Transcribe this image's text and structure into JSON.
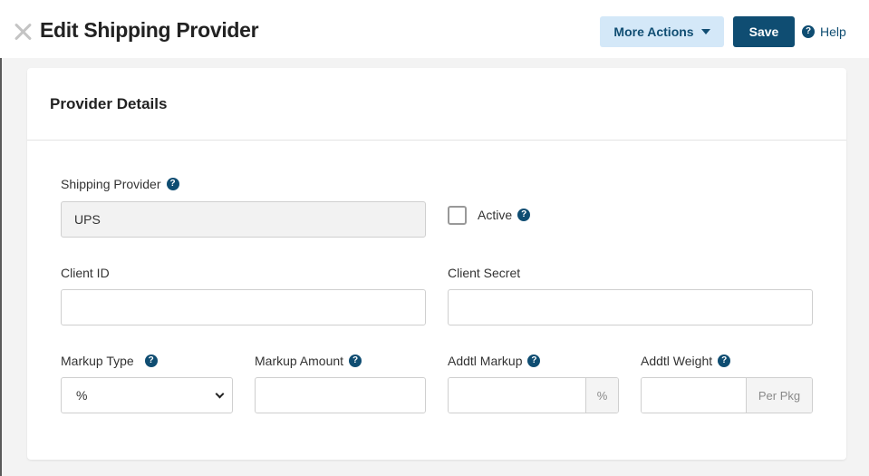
{
  "header": {
    "title": "Edit Shipping Provider",
    "more_actions_label": "More Actions",
    "save_label": "Save",
    "help_label": "Help"
  },
  "card": {
    "title": "Provider Details",
    "shipping_provider": {
      "label": "Shipping Provider",
      "value": "UPS"
    },
    "active": {
      "label": "Active",
      "checked": false
    },
    "client_id": {
      "label": "Client ID",
      "value": ""
    },
    "client_secret": {
      "label": "Client Secret",
      "value": ""
    },
    "markup_type": {
      "label": "Markup Type",
      "selected": "%"
    },
    "markup_amount": {
      "label": "Markup Amount",
      "value": ""
    },
    "addtl_markup": {
      "label": "Addtl Markup",
      "value": "",
      "suffix": "%"
    },
    "addtl_weight": {
      "label": "Addtl Weight",
      "value": "",
      "suffix": "Per Pkg"
    }
  },
  "icons": {
    "close": "close-icon",
    "caret": "caret-down-icon",
    "help": "question-circle-icon",
    "select": "chevron-down-icon"
  },
  "colors": {
    "primary": "#0f4d72",
    "secondary_button": "#d4e8f8"
  }
}
